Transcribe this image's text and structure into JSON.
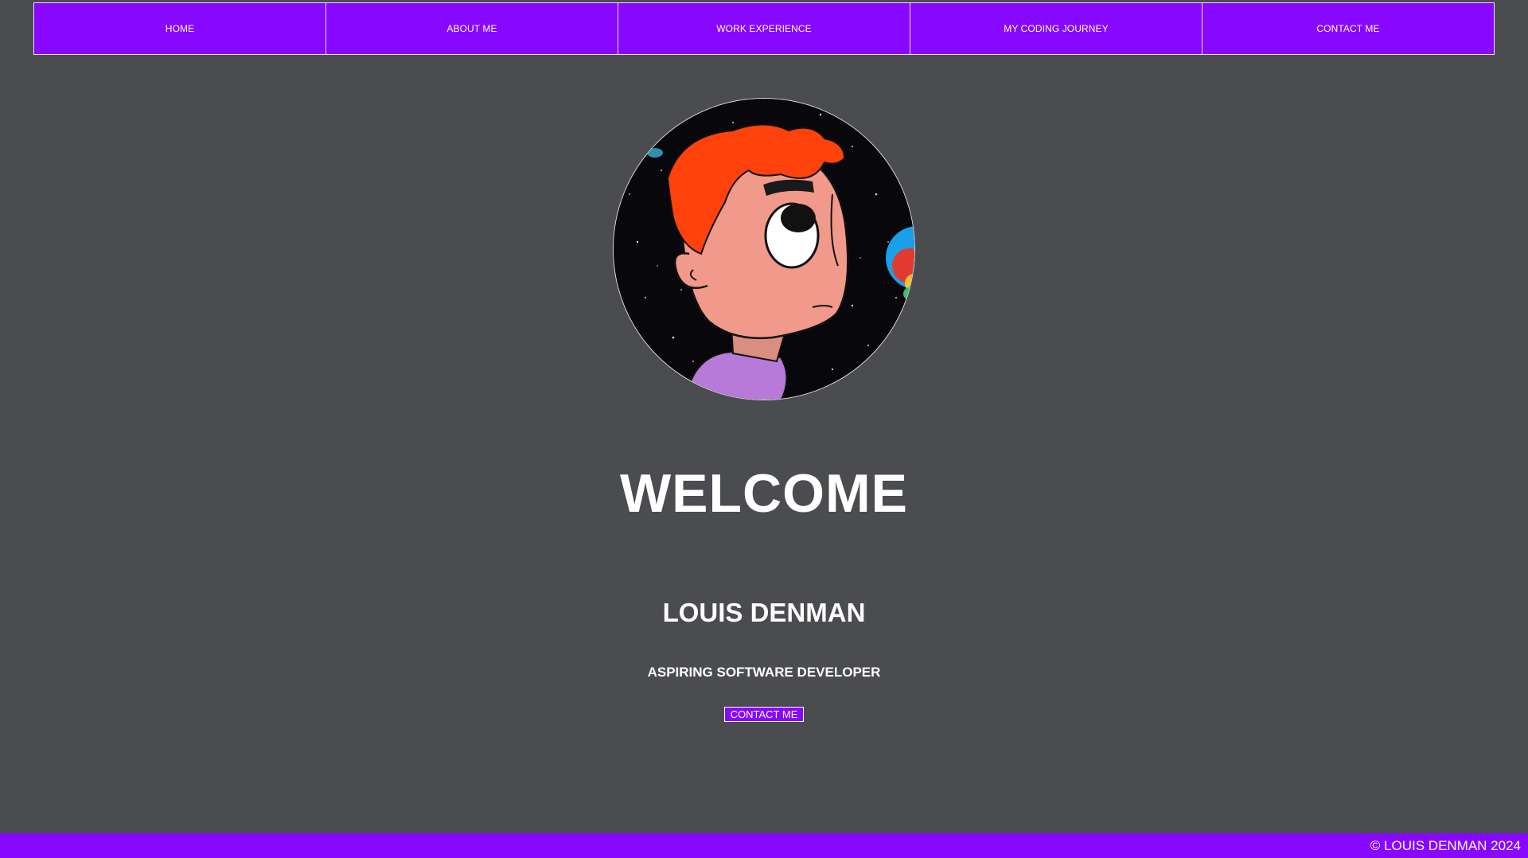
{
  "nav": {
    "items": [
      {
        "label": "HOME"
      },
      {
        "label": "ABOUT ME"
      },
      {
        "label": "WORK EXPERIENCE"
      },
      {
        "label": "MY CODING JOURNEY"
      },
      {
        "label": "CONTACT ME"
      }
    ]
  },
  "hero": {
    "title": "WELCOME",
    "name": "LOUIS DENMAN",
    "role": "ASPIRING SOFTWARE DEVELOPER",
    "cta_label": "CONTACT ME"
  },
  "footer": {
    "copyright": "© LOUIS DENMAN 2024"
  },
  "colors": {
    "accent": "#8707ff",
    "background": "#4b4c4f",
    "text": "#ffffff"
  },
  "icons": {
    "avatar": "cartoon-avatar-illustration"
  }
}
